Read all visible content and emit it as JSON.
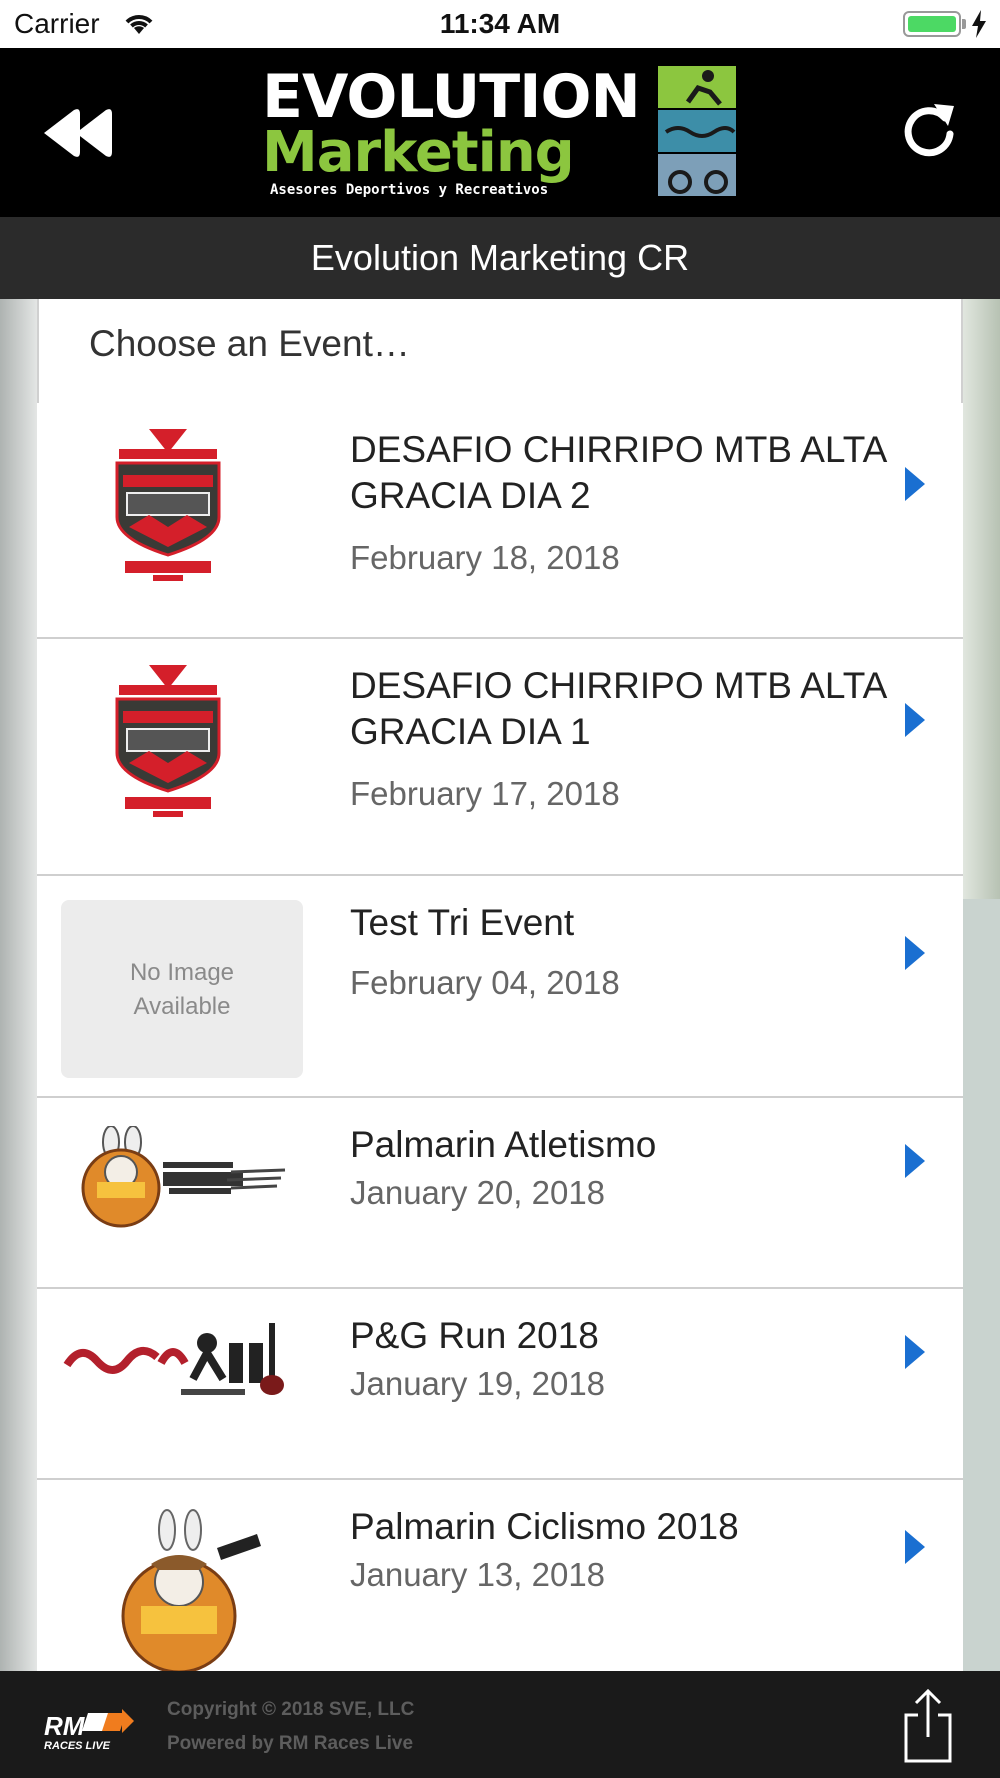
{
  "status_bar": {
    "carrier": "Carrier",
    "time": "11:34 AM"
  },
  "header": {
    "logo_line1": "EVOLUTION",
    "logo_line2": "Marketing",
    "logo_tagline": "Asesores Deportivos y Recreativos",
    "title": "Evolution Marketing CR"
  },
  "picker": {
    "label": "Choose an Event…"
  },
  "events": [
    {
      "name": "DESAFIO CHIRRIPO MTB ALTA GRACIA DIA 2",
      "date": "February 18, 2018",
      "logo": "desafio-chirripo-logo"
    },
    {
      "name": "DESAFIO CHIRRIPO MTB ALTA GRACIA DIA 1",
      "date": "February 17, 2018",
      "logo": "desafio-chirripo-logo"
    },
    {
      "name": "Test Tri Event",
      "date": "February 04, 2018",
      "logo": "no-image-placeholder"
    },
    {
      "name": "Palmarin Atletismo",
      "date": "January 20, 2018",
      "logo": "clasica-atletismo-logo"
    },
    {
      "name": "P&G Run 2018",
      "date": "January 19, 2018",
      "logo": "pura-life-run-logo"
    },
    {
      "name": "Palmarin Ciclismo 2018",
      "date": "January 13, 2018",
      "logo": "palmarin-mtb-logo"
    }
  ],
  "no_image": {
    "line1": "No Image",
    "line2": "Available"
  },
  "footer": {
    "copyright": "Copyright © 2018 SVE, LLC",
    "powered": "Powered by RM Races Live",
    "rm_logo_text": "RM",
    "rm_logo_sub": "RACES LIVE"
  },
  "colors": {
    "accent": "#1a6fd1",
    "brand_green": "#8cc63f",
    "header_bg": "#000000",
    "title_bar_bg": "#2b2b2b",
    "footer_bg": "#1a1a1a"
  }
}
